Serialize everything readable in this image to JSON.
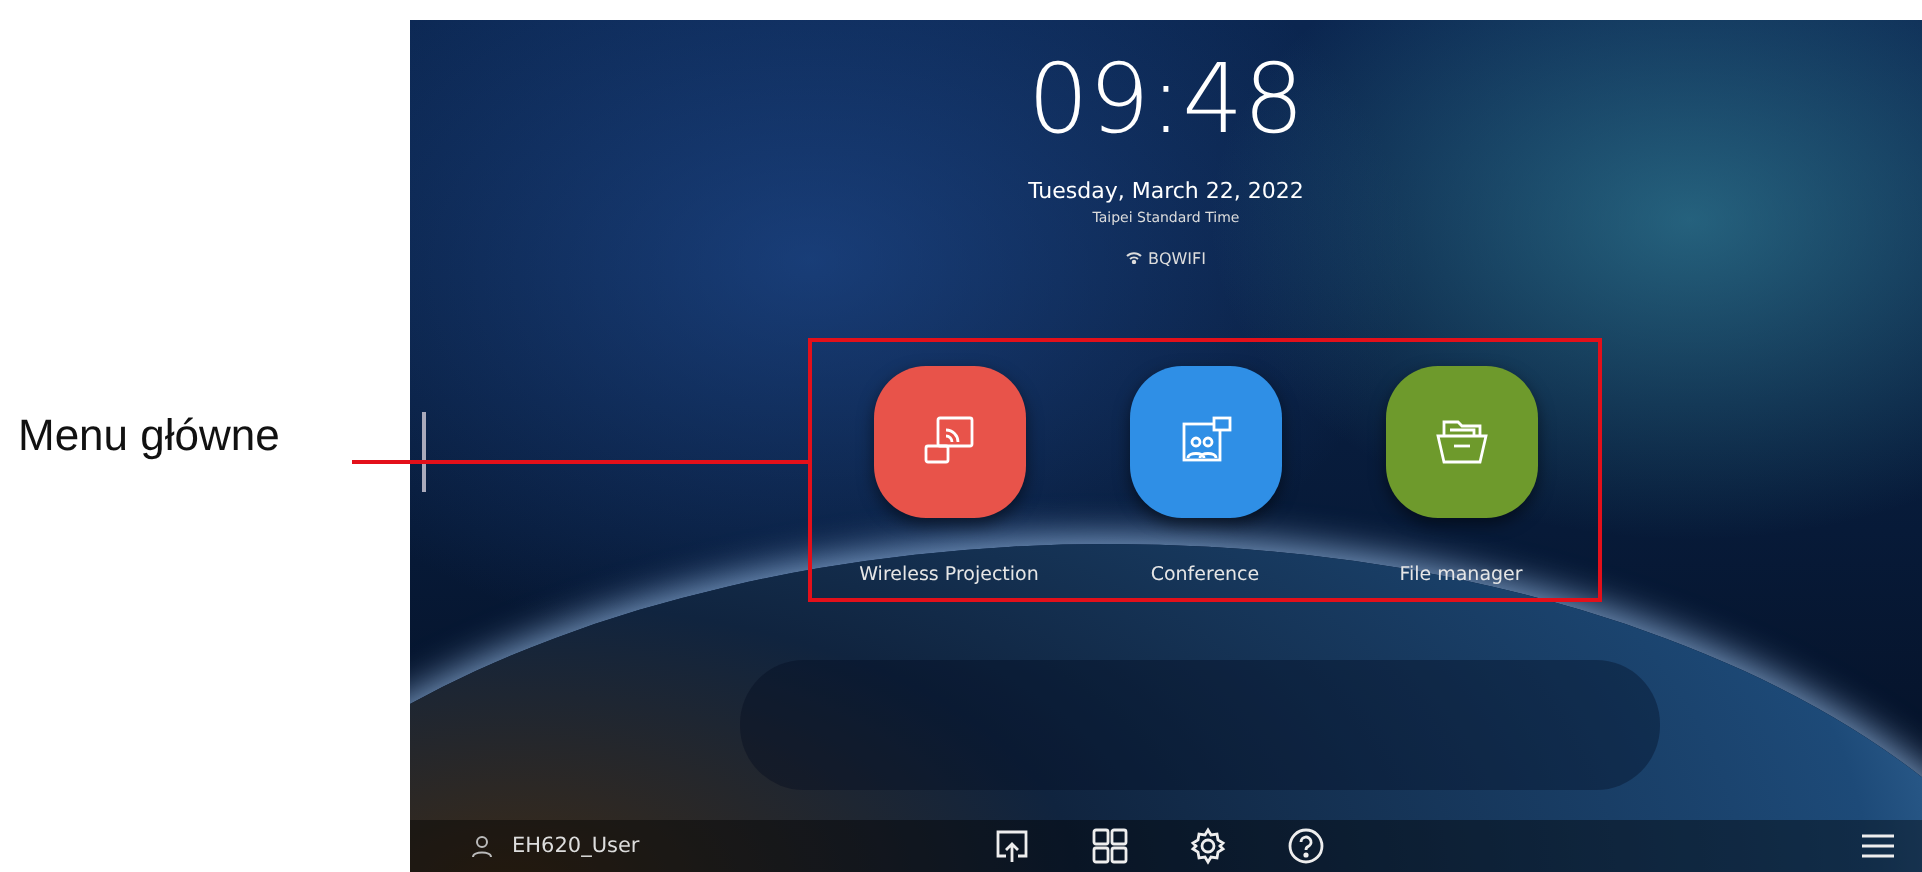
{
  "callout": {
    "label": "Menu główne"
  },
  "home_screen": {
    "clock": "09:48",
    "date": "Tuesday, March 22, 2022",
    "time_zone": "Taipei Standard Time",
    "wifi_name": "BQWIFI",
    "apps": [
      {
        "label": "Wireless Projection",
        "color": "#e8534a"
      },
      {
        "label": "Conference",
        "color": "#2f8fe6"
      },
      {
        "label": "File manager",
        "color": "#6e9a2c"
      }
    ],
    "bottom_bar": {
      "user_name": "EH620_User"
    }
  }
}
